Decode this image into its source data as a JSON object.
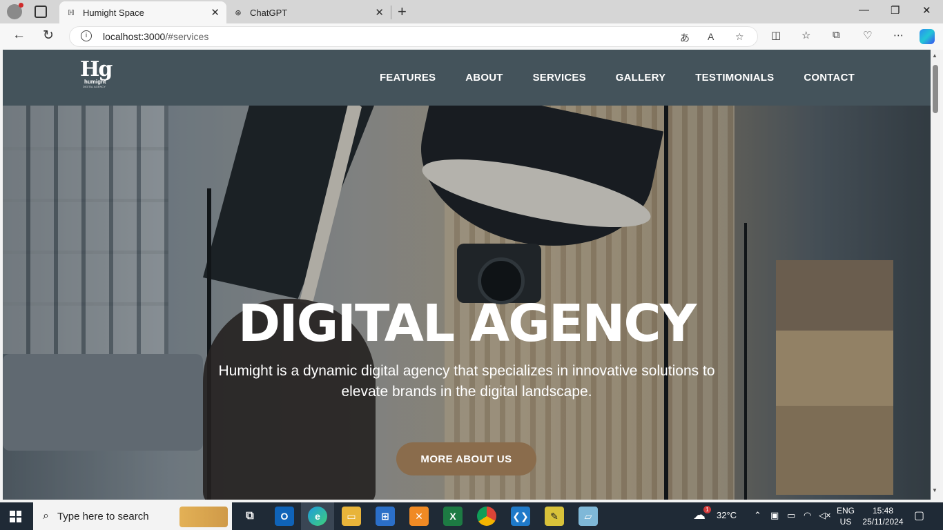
{
  "browser": {
    "tabs": [
      {
        "title": "Humight Space",
        "favicon": "humight-favicon-icon",
        "active": true
      },
      {
        "title": "ChatGPT",
        "favicon": "chatgpt-favicon-icon",
        "active": false
      }
    ],
    "url_host": "localhost:3000",
    "url_path": "/#services"
  },
  "site": {
    "logo": {
      "mark": "Hg",
      "word": "humight",
      "tagline": "DIGITAL AGENCY"
    },
    "nav": [
      "FEATURES",
      "ABOUT",
      "SERVICES",
      "GALLERY",
      "TESTIMONIALS",
      "CONTACT"
    ],
    "hero": {
      "title": "DIGITAL AGENCY",
      "description": "Humight is a dynamic digital agency that specializes in innovative solutions to elevate brands in the digital landscape.",
      "cta": "MORE ABOUT US"
    }
  },
  "taskbar": {
    "search_placeholder": "Type here to search",
    "weather_temp": "32°C",
    "weather_badge": "1",
    "lang_line1": "ENG",
    "lang_line2": "US",
    "time": "15:48",
    "date": "25/11/2024"
  },
  "colors": {
    "header_bg": "#44535b",
    "cta_bg": "#8a6c4c",
    "taskbar_bg": "#1f2a36"
  }
}
